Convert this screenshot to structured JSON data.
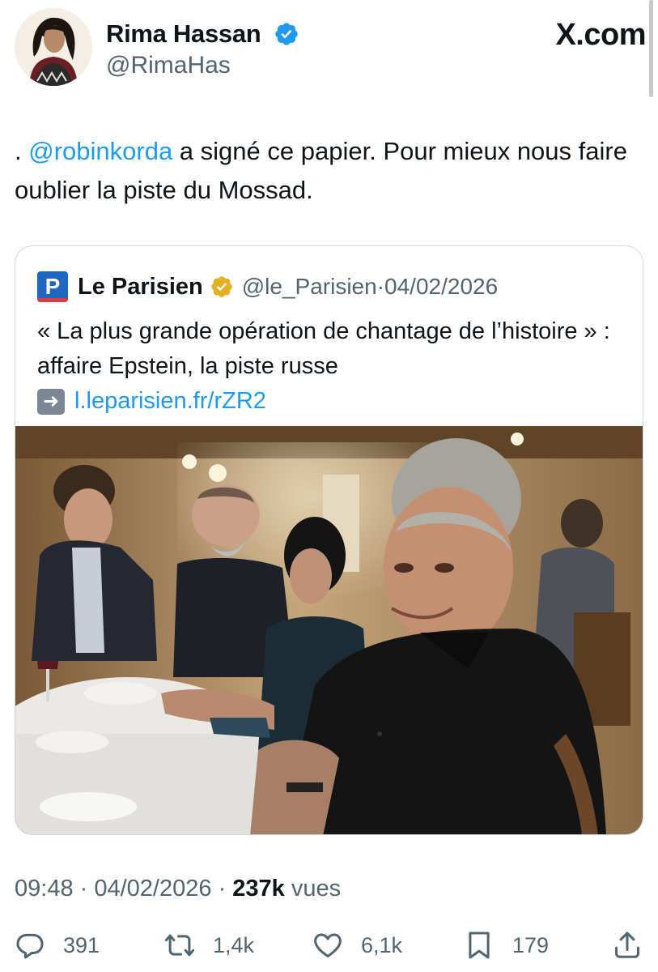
{
  "author": {
    "name": "Rima Hassan",
    "handle": "@RimaHas",
    "verified": "blue-check-icon"
  },
  "source_label": "X.com",
  "tweet": {
    "prefix": ". ",
    "mention": "@robinkorda",
    "text": " a signé ce papier. Pour mieux nous faire oublier la piste du Mossad."
  },
  "quote": {
    "account_name": "Le Parisien",
    "logo_letter": "P",
    "handle": "@le_Parisien",
    "separator": " · ",
    "date": "04/02/2026",
    "text": "« La plus grande opération de chantage de l’histoire » : affaire Epstein, la piste russe",
    "link_icon": "right-arrow-icon",
    "link": "l.leparisien.fr/rZR2"
  },
  "meta": {
    "time": "09:48",
    "separator1": " · ",
    "date": "04/02/2026",
    "separator2": " · ",
    "views_count": "237k",
    "views_label": " vues"
  },
  "actions": {
    "replies": "391",
    "reposts": "1,4k",
    "likes": "6,1k",
    "bookmarks": "179"
  },
  "colors": {
    "accent": "#1d9bf0",
    "text": "#0f1419",
    "muted": "#536471",
    "border": "#cfd9de",
    "verified_gold": "#e3b024",
    "brand_parisien": "#1f68c1"
  }
}
